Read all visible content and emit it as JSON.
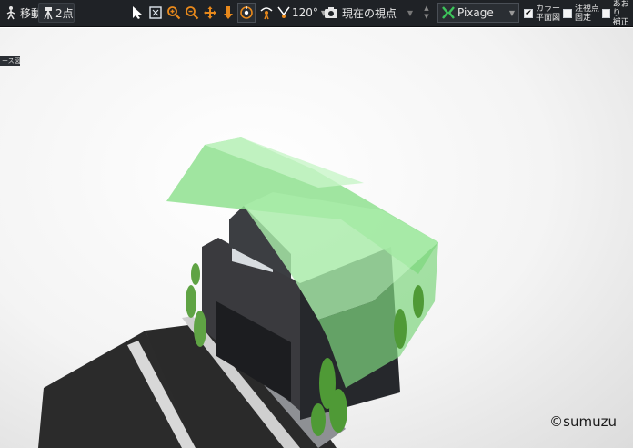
{
  "toolbar": {
    "move_label": "移動",
    "two_point_label": "2点",
    "fov_value": "120°",
    "viewpoint_label": "現在の視点",
    "render_engine": "Pixage",
    "color_plan_label_line1": "カラー",
    "color_plan_label_line2": "平面図",
    "color_plan_checked": true,
    "fix_gaze_label_line1": "注視点",
    "fix_gaze_label_line2": "固定",
    "fix_gaze_checked": false,
    "tilt_correct_label_line1": "あおり",
    "tilt_correct_label_line2": "補正",
    "tilt_correct_checked": false,
    "icons": [
      "select-arrow-icon",
      "fit-view-icon",
      "zoom-in-icon",
      "zoom-out-icon",
      "pan-icon",
      "move-down-icon",
      "orbit-icon",
      "walk-icon",
      "fov-icon",
      "camera-icon"
    ],
    "accent_color": "#e8891c"
  },
  "viewport": {
    "tab_label": "ース図",
    "watermark": "©sumuzu"
  }
}
